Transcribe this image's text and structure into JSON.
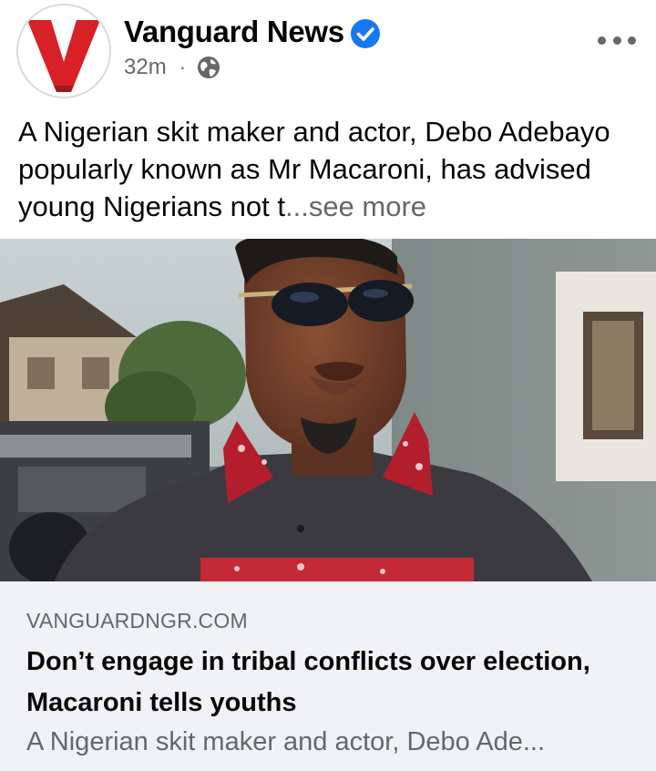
{
  "post": {
    "page_name": "Vanguard News",
    "time": "32m",
    "separator": "·",
    "caption_text": "A Nigerian skit maker and actor, Debo Adebayo popularly known as Mr Macaroni, has advised young Nigerians not t",
    "caption_ellipsis": "...",
    "see_more_label": "see more",
    "icons": {
      "verified": "verified-badge-icon",
      "audience": "globe-icon",
      "more": "more-options-icon"
    },
    "colors": {
      "brand_red": "#d92027",
      "verified_blue": "#1877f2",
      "secondary_text": "#65676b",
      "card_background": "#f0f2f5"
    }
  },
  "link_card": {
    "domain": "VANGUARDNGR.COM",
    "title": "Don’t engage in tribal conflicts over election, Macaroni tells youths",
    "description": "A Nigerian skit maker and actor, Debo Ade..."
  }
}
